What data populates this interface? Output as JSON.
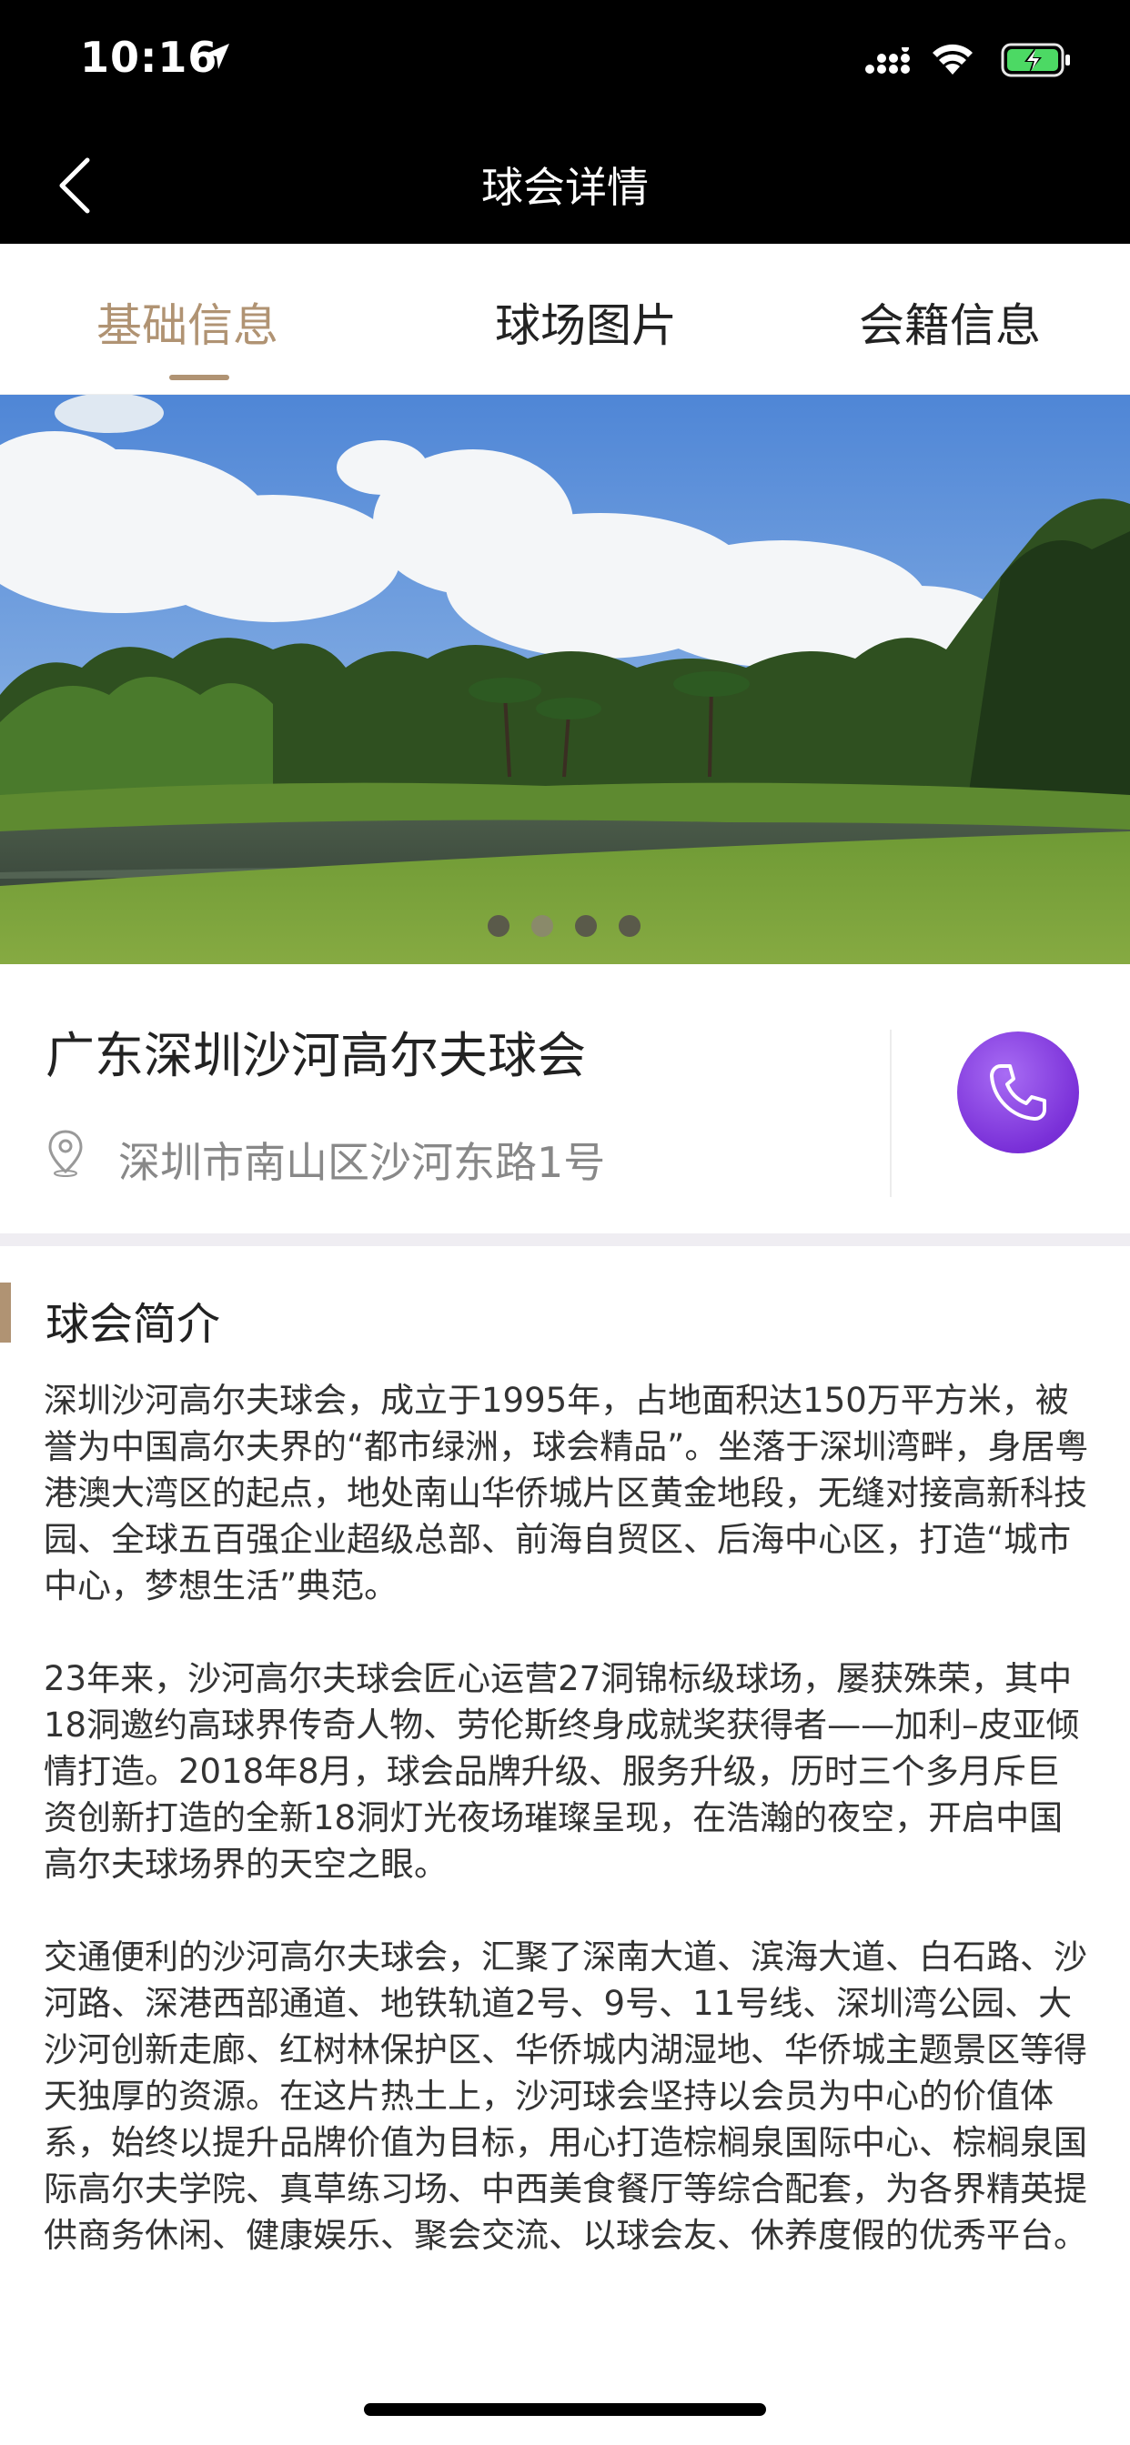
{
  "status_bar": {
    "time": "10:16"
  },
  "nav": {
    "title": "球会详情"
  },
  "tabs": [
    {
      "label": "基础信息",
      "active": true
    },
    {
      "label": "球场图片",
      "active": false
    },
    {
      "label": "会籍信息",
      "active": false
    }
  ],
  "banner": {
    "slide_count": 4,
    "active_index": 1
  },
  "club": {
    "name": "广东深圳沙河高尔夫球会",
    "address": "深圳市南山区沙河东路1号"
  },
  "intro": {
    "title": "球会简介",
    "paragraphs": [
      "深圳沙河高尔夫球会，成立于1995年，占地面积达150万平方米，被誉为中国高尔夫界的“都市绿洲，球会精品”。坐落于深圳湾畔，身居粤港澳大湾区的起点，地处南山华侨城片区黄金地段，无缝对接高新科技园、全球五百强企业超级总部、前海自贸区、后海中心区，打造“城市中心，梦想生活”典范。",
      "23年来，沙河高尔夫球会匠心运营27洞锦标级球场，屡获殊荣，其中18洞邀约高球界传奇人物、劳伦斯终身成就奖获得者——加利–皮亚倾情打造。2018年8月，球会品牌升级、服务升级，历时三个多月斥巨资创新打造的全新18洞灯光夜场璀璨呈现，在浩瀚的夜空，开启中国高尔夫球场界的天空之眼。",
      "交通便利的沙河高尔夫球会，汇聚了深南大道、滨海大道、白石路、沙河路、深港西部通道、地铁轨道2号、9号、11号线、深圳湾公园、大沙河创新走廊、红树林保护区、华侨城内湖湿地、华侨城主题景区等得天独厚的资源。在这片热土上，沙河球会坚持以会员为中心的价值体系，始终以提升品牌价值为目标，用心打造棕榈泉国际中心、棕榈泉国际高尔夫学院、真草练习场、中西美食餐厅等综合配套，为各界精英提供商务休闲、健康娱乐、聚会交流、以球会友、休养度假的优秀平台。"
    ]
  },
  "colors": {
    "accent": "#b09373",
    "call_button": "#7a30d8",
    "nav_background": "#000000"
  },
  "icons": [
    "location-arrow-icon",
    "signal-icon",
    "wifi-icon",
    "battery-charging-icon",
    "back-chevron-icon",
    "location-pin-icon",
    "phone-icon"
  ]
}
